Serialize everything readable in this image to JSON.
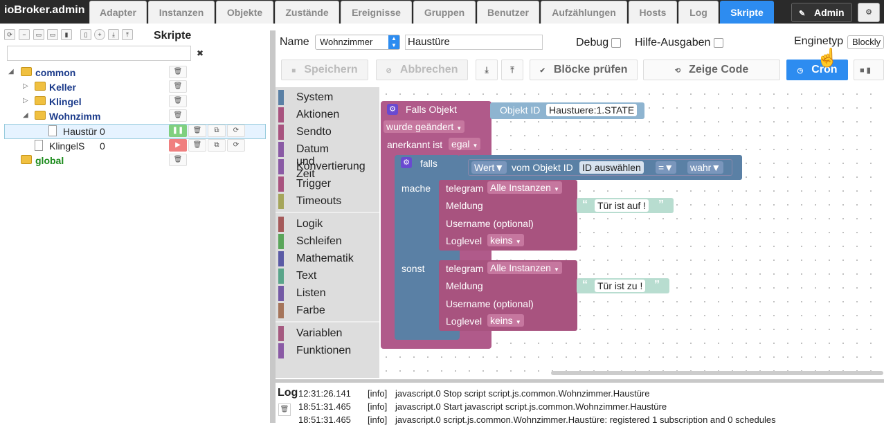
{
  "app": {
    "brand": "ioBroker.admin"
  },
  "tabs": [
    "Adapter",
    "Instanzen",
    "Objekte",
    "Zustände",
    "Ereignisse",
    "Gruppen",
    "Benutzer",
    "Aufzählungen",
    "Hosts",
    "Log",
    "Skripte"
  ],
  "active_tab": "Skripte",
  "admin_button": {
    "label": "Admin",
    "icon": "pencil-icon"
  },
  "settings_icon": "gear-icon",
  "left_panel": {
    "title": "Skripte",
    "search": {
      "value": "",
      "placeholder": ""
    },
    "clear_icon": "close-icon",
    "toolbar_icons": [
      "refresh-icon",
      "collapse-icon",
      "folder-open-icon",
      "folder-icon",
      "edit-icon",
      "new-file-icon",
      "add-circle-icon",
      "download-icon",
      "upload-icon"
    ],
    "tree": [
      {
        "label": "common",
        "type": "folder",
        "level": 0,
        "expanded": true
      },
      {
        "label": "Keller",
        "type": "folder",
        "level": 1,
        "expanded": false
      },
      {
        "label": "Klingel",
        "type": "folder",
        "level": 1,
        "expanded": false
      },
      {
        "label": "Wohnzimm",
        "type": "folder",
        "level": 1,
        "expanded": true
      },
      {
        "label": "Haustür",
        "count": "0",
        "type": "script",
        "level": 2,
        "running": true,
        "selected": true
      },
      {
        "label": "KlingelS",
        "count": "0",
        "type": "script",
        "level": 1,
        "running": false
      },
      {
        "label": "global",
        "type": "folder",
        "level": 0,
        "expanded": false
      }
    ]
  },
  "editor": {
    "name_label": "Name",
    "folder_select": "Wohnzimmer",
    "name_value": "Haustüre",
    "debug_label": "Debug",
    "debug_checked": false,
    "hilfe_label": "Hilfe-Ausgaben",
    "hilfe_checked": false,
    "engine_label": "Enginetyp",
    "engine_value": "Blockly",
    "buttons": {
      "save": "Speichern",
      "cancel": "Abbrechen",
      "check": "Blöcke prüfen",
      "show_code": "Zeige Code",
      "cron": "Cron"
    }
  },
  "toolbox": {
    "groups": [
      [
        {
          "label": "System",
          "color": "#5a80a5"
        },
        {
          "label": "Aktionen",
          "color": "#a8537f"
        },
        {
          "label": "Sendto",
          "color": "#a8537f"
        },
        {
          "label": "Datum und Zeit",
          "color": "#8a5aa5"
        },
        {
          "label": "Konvertierung",
          "color": "#8a5aa5"
        },
        {
          "label": "Trigger",
          "color": "#a8537f"
        },
        {
          "label": "Timeouts",
          "color": "#a5a55a"
        }
      ],
      [
        {
          "label": "Logik",
          "color": "#a55a5a"
        },
        {
          "label": "Schleifen",
          "color": "#5aa55a"
        },
        {
          "label": "Mathematik",
          "color": "#5a5aa5"
        },
        {
          "label": "Text",
          "color": "#5aa58a"
        },
        {
          "label": "Listen",
          "color": "#745aa5"
        },
        {
          "label": "Farbe",
          "color": "#a5745a"
        }
      ],
      [
        {
          "label": "Variablen",
          "color": "#a55a80"
        },
        {
          "label": "Funktionen",
          "color": "#8a5aa5"
        }
      ]
    ]
  },
  "blocks": {
    "trigger": {
      "title": "Falls Objekt",
      "object_label": "Objekt ID",
      "object_value": "Haustuere:1.STATE",
      "changed": "wurde geändert",
      "ack_label": "anerkannt ist",
      "ack_value": "egal"
    },
    "if": {
      "label": "falls",
      "mache": "mache",
      "sonst": "sonst"
    },
    "condition": {
      "field": "Wert",
      "from_label": "vom Objekt ID",
      "id_value": "ID auswählen",
      "op": "=",
      "value": "wahr"
    },
    "telegram1": {
      "title": "telegram",
      "instance": "Alle Instanzen",
      "message_label": "Meldung",
      "message": "Tür ist auf !",
      "username_label": "Username (optional)",
      "loglevel_label": "Loglevel",
      "loglevel": "keins"
    },
    "telegram2": {
      "title": "telegram",
      "instance": "Alle Instanzen",
      "message_label": "Meldung",
      "message": "Tür ist zu !",
      "username_label": "Username (optional)",
      "loglevel_label": "Loglevel",
      "loglevel": "keins"
    }
  },
  "log": {
    "title": "Log",
    "lines": [
      {
        "time": "12:31:26.141",
        "level": "[info]",
        "msg": "javascript.0 Stop script script.js.common.Wohnzimmer.Haustüre"
      },
      {
        "time": "18:51:31.465",
        "level": "[info]",
        "msg": "javascript.0 Start javascript script.js.common.Wohnzimmer.Haustüre"
      },
      {
        "time": "18:51:31.465",
        "level": "[info]",
        "msg": "javascript.0 script.js.common.Wohnzimmer.Haustüre: registered 1 subscription and 0 schedules"
      }
    ]
  }
}
